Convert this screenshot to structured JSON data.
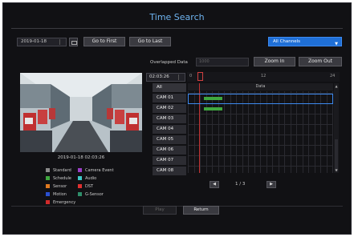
{
  "header": {
    "title": "Time Search"
  },
  "toolbar": {
    "date_value": "2019-01-18",
    "go_to_first_label": "Go to First",
    "go_to_last_label": "Go to Last",
    "channel_select_value": "All Channels"
  },
  "preview": {
    "timestamp": "2019-01-18 02:03:26"
  },
  "legend": {
    "items": [
      {
        "label": "Standard",
        "color": "#8a8a8a"
      },
      {
        "label": "Camera Event",
        "color": "#9b3fc8"
      },
      {
        "label": "Schedule",
        "color": "#3fa83f"
      },
      {
        "label": "Audio",
        "color": "#3fc8c8"
      },
      {
        "label": "Sensor",
        "color": "#e07a20"
      },
      {
        "label": "DST",
        "color": "#e03030"
      },
      {
        "label": "Motion",
        "color": "#2a50d0"
      },
      {
        "label": "G-Sensor",
        "color": "#2e8e6a"
      },
      {
        "label": "Emergency",
        "color": "#d02a2a"
      }
    ]
  },
  "timeline": {
    "overlapped_label": "Overlapped Data",
    "overlapped_value": "1000",
    "zoom_in_label": "Zoom In",
    "zoom_out_label": "Zoom Out",
    "time_value": "02:03:26",
    "ruler_ticks": [
      "0",
      "12",
      "24"
    ],
    "grid_header": "Data",
    "all_label": "All",
    "channels": [
      "CAM 01",
      "CAM 02",
      "CAM 03",
      "CAM 04",
      "CAM 05",
      "CAM 06",
      "CAM 07",
      "CAM 08"
    ],
    "page_text": "1 / 3",
    "prev_label": "◀",
    "next_label": "▶"
  },
  "footer": {
    "play_label": "Play",
    "return_label": "Return"
  }
}
